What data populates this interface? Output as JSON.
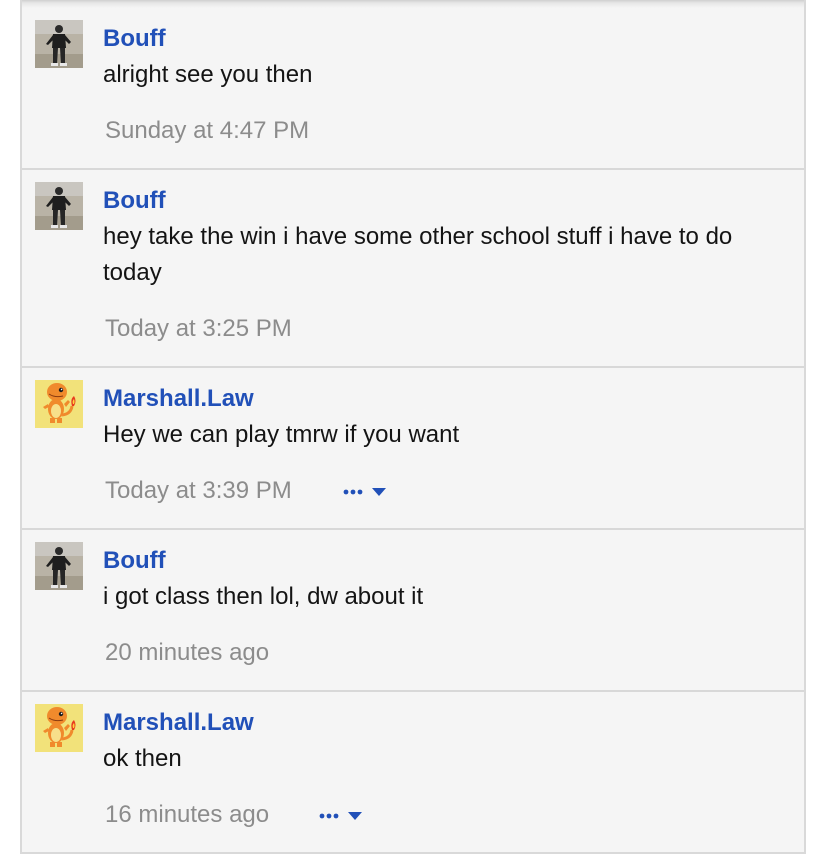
{
  "messages": [
    {
      "author": "Bouff",
      "text": "alright see you then",
      "time": "Sunday at 4:47 PM",
      "avatar": "person-avatar",
      "has_menu": false
    },
    {
      "author": "Bouff",
      "text": "hey take the win i have some other school stuff i have to do today",
      "time": "Today at 3:25 PM",
      "avatar": "person-avatar",
      "has_menu": false
    },
    {
      "author": "Marshall.Law",
      "text": "Hey we can play tmrw if you want",
      "time": "Today at 3:39 PM",
      "avatar": "charmander-avatar",
      "has_menu": true
    },
    {
      "author": "Bouff",
      "text": "i got class then lol, dw about it",
      "time": "20 minutes ago",
      "avatar": "person-avatar",
      "has_menu": false
    },
    {
      "author": "Marshall.Law",
      "text": "ok then",
      "time": "16 minutes ago",
      "avatar": "charmander-avatar",
      "has_menu": true
    }
  ],
  "colors": {
    "author": "#2150b8",
    "timestamp": "#8c8c8c",
    "background": "#f5f5f5",
    "divider": "#d8d8d8"
  }
}
